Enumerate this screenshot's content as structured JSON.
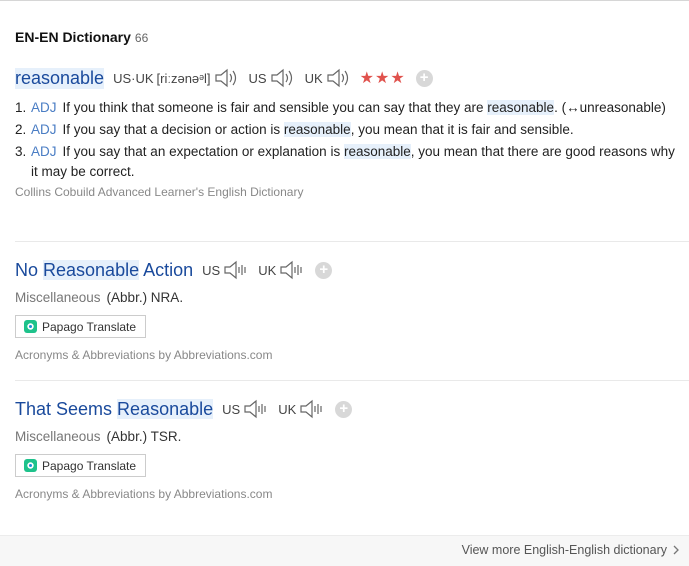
{
  "section": {
    "title": "EN-EN Dictionary",
    "count": "66"
  },
  "entries": [
    {
      "headword": "reasonable",
      "pron_label": "US·UK",
      "phonetic": "[riːzənəᵊl]",
      "us_label": "US",
      "uk_label": "UK",
      "stars": "★★★",
      "senses": [
        {
          "num": "1.",
          "pos": "ADJ",
          "pre": "If you think that someone is fair and sensible you can say that they are ",
          "hl": "reasonable",
          "post": ". (↔unreasonable)"
        },
        {
          "num": "2.",
          "pos": "ADJ",
          "pre": "If you say that a decision or action is ",
          "hl": "reasonable",
          "post": ", you mean that it is fair and sensible."
        },
        {
          "num": "3.",
          "pos": "ADJ",
          "pre": "If you say that an expectation or explanation is ",
          "hl": "reasonable",
          "post": ", you mean that there are good reasons why it may be correct."
        }
      ],
      "source": "Collins Cobuild Advanced Learner's English Dictionary"
    },
    {
      "head_pre": "No ",
      "head_hl": "Reasonable",
      "head_post": " Action",
      "us_label": "US",
      "uk_label": "UK",
      "category": "Miscellaneous",
      "definition": "(Abbr.) NRA.",
      "papago_label": "Papago Translate",
      "source": "Acronyms & Abbreviations by Abbreviations.com"
    },
    {
      "head_pre": "That Seems ",
      "head_hl": "Reasonable",
      "head_post": "",
      "us_label": "US",
      "uk_label": "UK",
      "category": "Miscellaneous",
      "definition": "(Abbr.) TSR.",
      "papago_label": "Papago Translate",
      "source": "Acronyms & Abbreviations by Abbreviations.com"
    }
  ],
  "footer": {
    "view_more": "View more English-English dictionary"
  },
  "icons": [
    "speaker-icon",
    "plus-icon",
    "papago-icon",
    "chevron-right-icon"
  ],
  "colors": {
    "headword": "#1a4a9c",
    "highlight": "#e6f0fb",
    "stars": "#e0524d",
    "pos": "#4a7dc4"
  }
}
